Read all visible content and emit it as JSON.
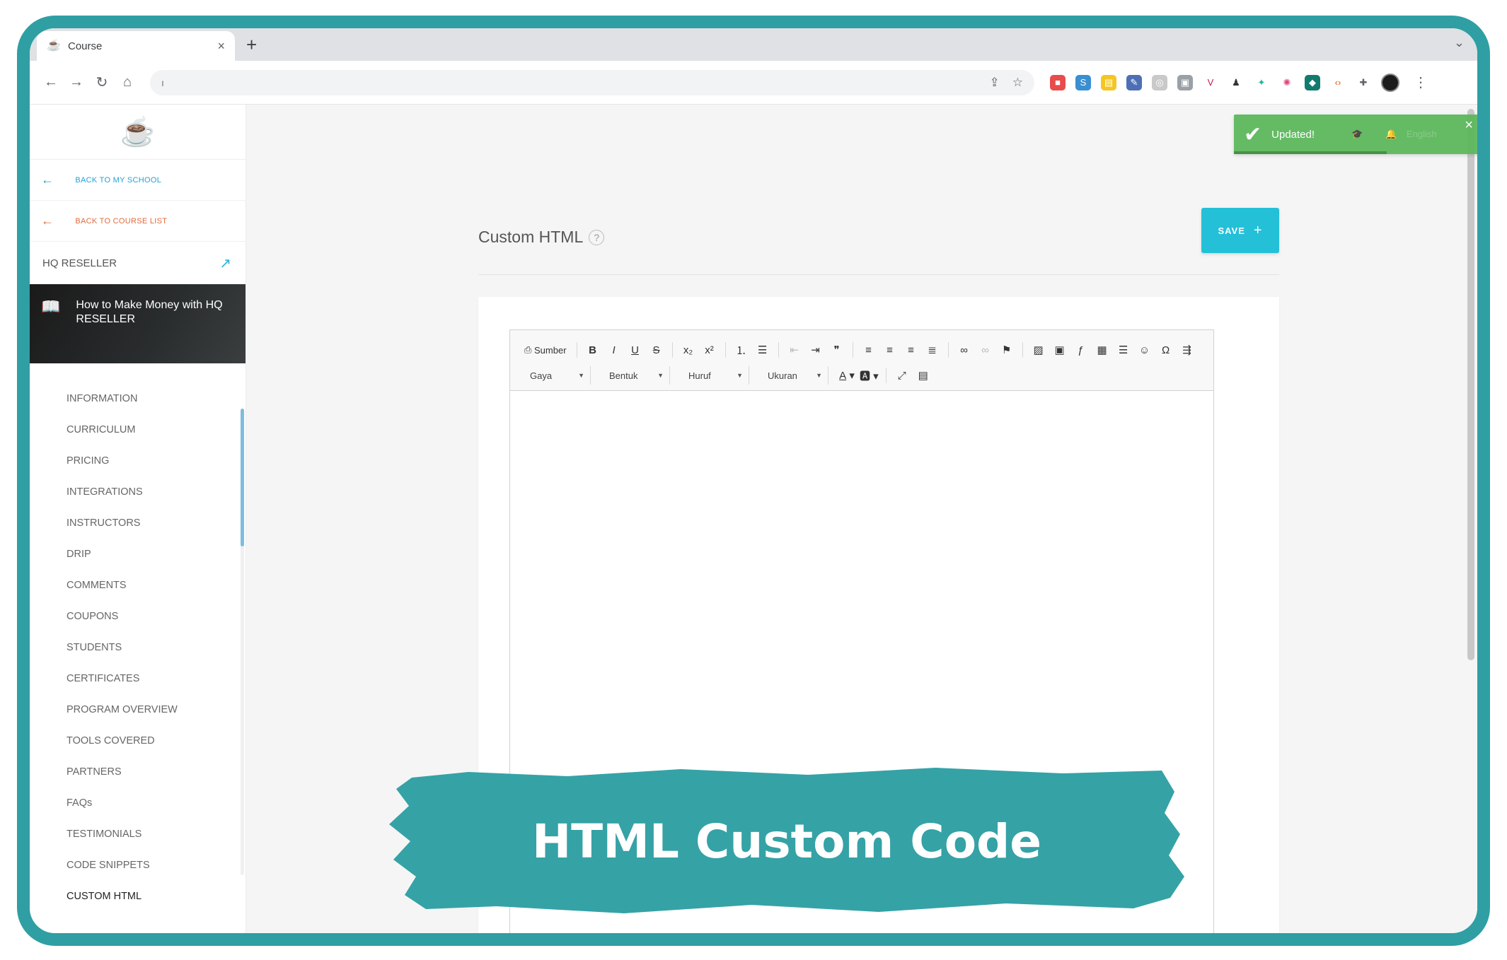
{
  "browser": {
    "tab_title": "Course",
    "tab_favicon": "coffee-mug-icon",
    "new_tab": "+",
    "tab_close": "×",
    "address_value": "",
    "address_placeholder": "ı"
  },
  "sidebar": {
    "back_school": "BACK TO MY SCHOOL",
    "back_course": "BACK TO COURSE LIST",
    "school_name": "HQ RESELLER",
    "course_title": "How to Make Money with HQ RESELLER",
    "menu": [
      "INFORMATION",
      "CURRICULUM",
      "PRICING",
      "INTEGRATIONS",
      "INSTRUCTORS",
      "DRIP",
      "COMMENTS",
      "COUPONS",
      "STUDENTS",
      "CERTIFICATES",
      "PROGRAM OVERVIEW",
      "TOOLS COVERED",
      "PARTNERS",
      "FAQs",
      "TESTIMONIALS",
      "CODE SNIPPETS",
      "CUSTOM HTML"
    ],
    "active_item": "CUSTOM HTML"
  },
  "main": {
    "title": "Custom HTML",
    "help": "?",
    "save_label": "SAVE",
    "save_icon": "+"
  },
  "editor": {
    "source_label": "Sumber",
    "style_combo": "Gaya",
    "format_combo": "Bentuk",
    "font_combo": "Huruf",
    "size_combo": "Ukuran"
  },
  "toast": {
    "message": "Updated!",
    "close": "×",
    "ghost_label": "English"
  },
  "overlay": {
    "caption": "HTML Custom Code"
  },
  "colors": {
    "frame": "#2f9fa3",
    "accent": "#23c0d8",
    "toast": "#5cb85c",
    "banner": "#35a2a6"
  }
}
